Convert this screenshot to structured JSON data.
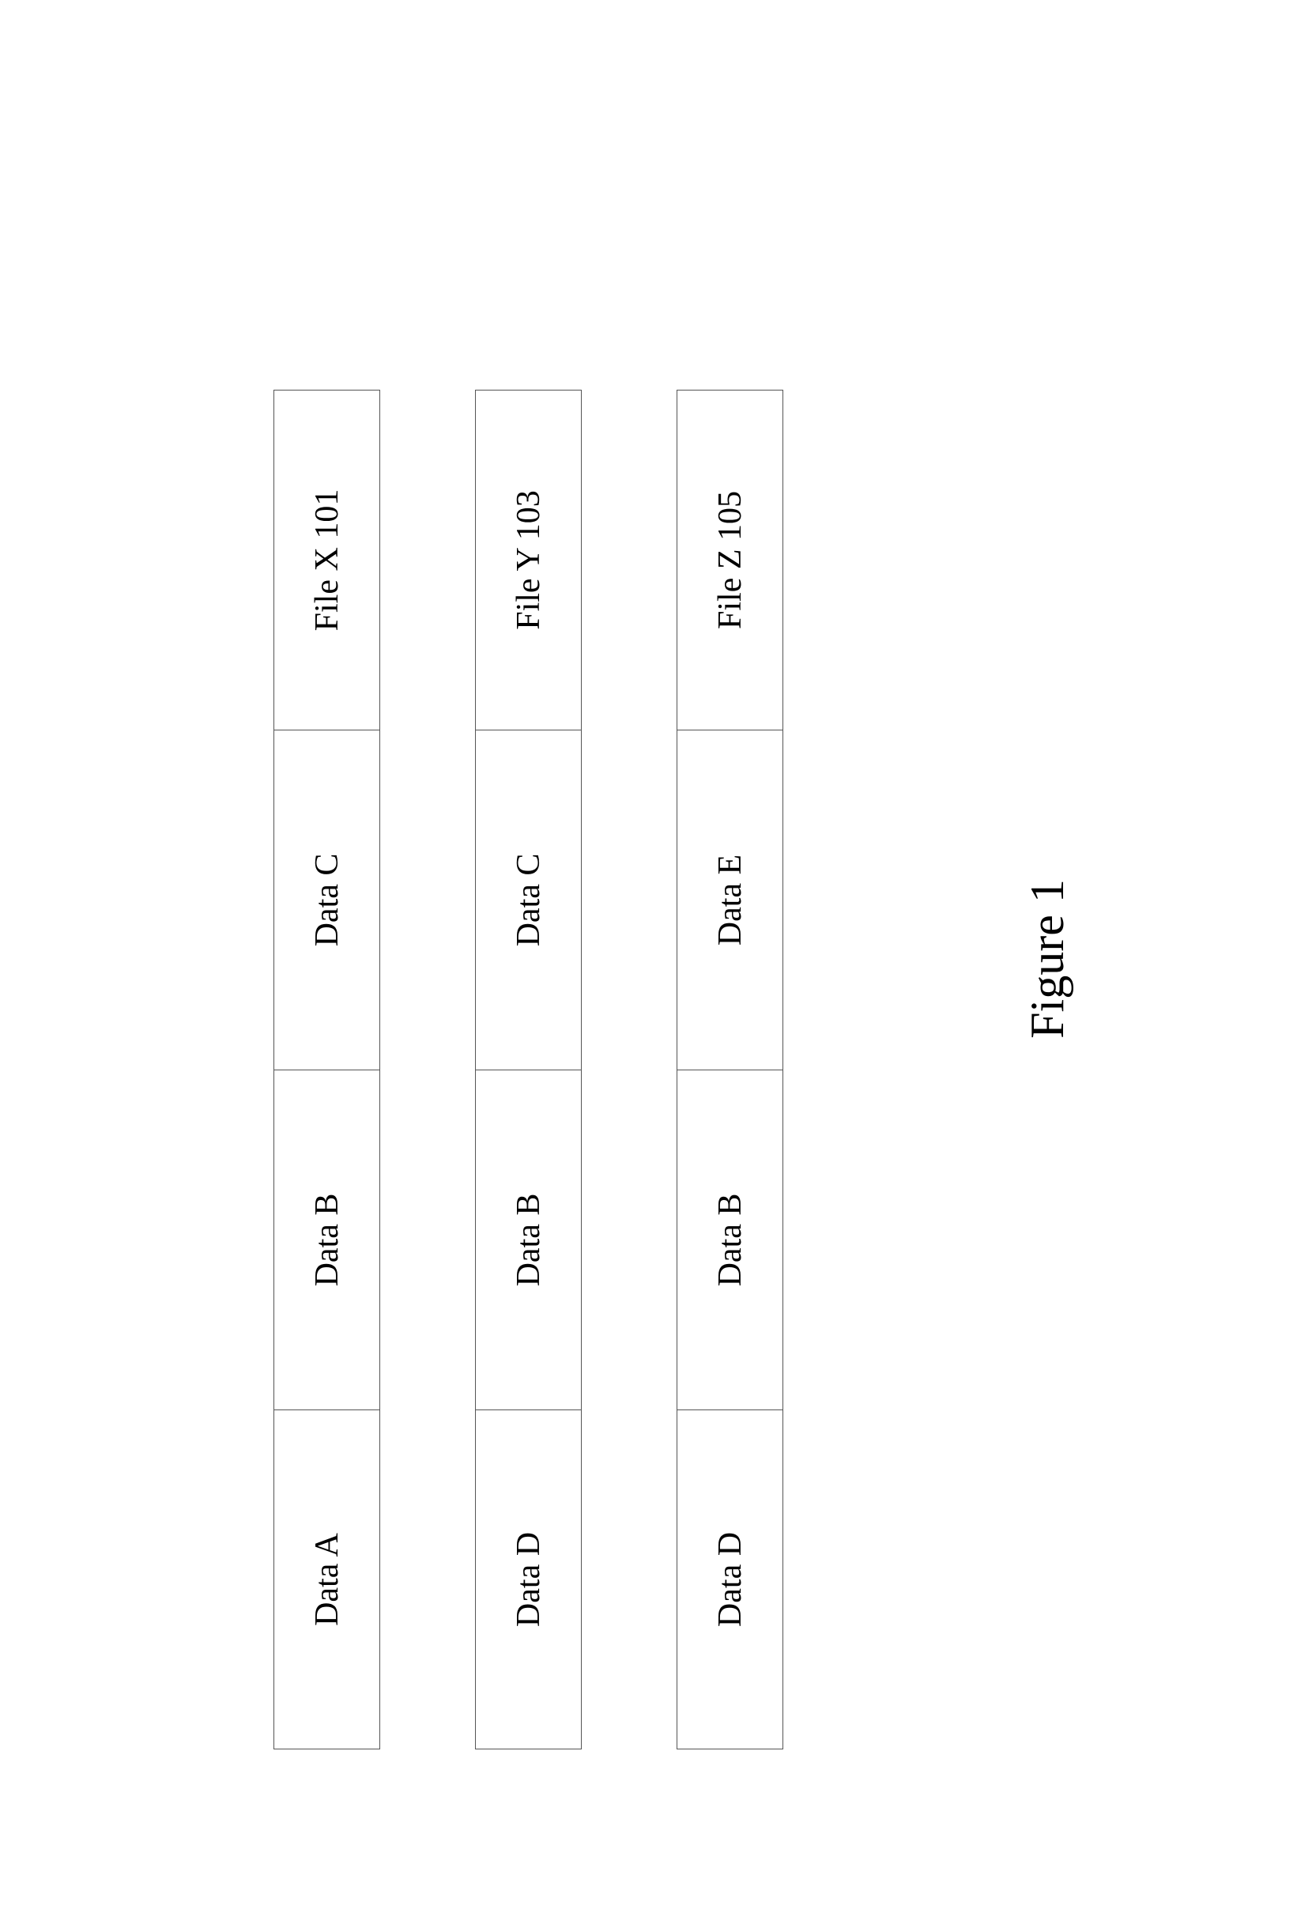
{
  "files": [
    {
      "label": "File X 101",
      "data": [
        "Data A",
        "Data B",
        "Data C"
      ]
    },
    {
      "label": "File Y 103",
      "data": [
        "Data D",
        "Data B",
        "Data C"
      ]
    },
    {
      "label": "File Z 105",
      "data": [
        "Data D",
        "Data B",
        "Data E"
      ]
    }
  ],
  "caption": "Figure 1"
}
